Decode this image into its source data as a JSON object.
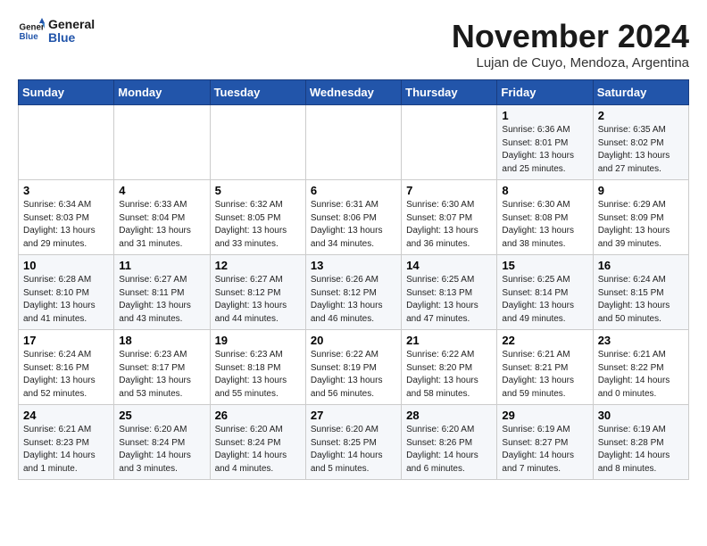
{
  "header": {
    "logo_line1": "General",
    "logo_line2": "Blue",
    "month_year": "November 2024",
    "location": "Lujan de Cuyo, Mendoza, Argentina"
  },
  "weekdays": [
    "Sunday",
    "Monday",
    "Tuesday",
    "Wednesday",
    "Thursday",
    "Friday",
    "Saturday"
  ],
  "weeks": [
    [
      {
        "day": "",
        "content": ""
      },
      {
        "day": "",
        "content": ""
      },
      {
        "day": "",
        "content": ""
      },
      {
        "day": "",
        "content": ""
      },
      {
        "day": "",
        "content": ""
      },
      {
        "day": "1",
        "content": "Sunrise: 6:36 AM\nSunset: 8:01 PM\nDaylight: 13 hours\nand 25 minutes."
      },
      {
        "day": "2",
        "content": "Sunrise: 6:35 AM\nSunset: 8:02 PM\nDaylight: 13 hours\nand 27 minutes."
      }
    ],
    [
      {
        "day": "3",
        "content": "Sunrise: 6:34 AM\nSunset: 8:03 PM\nDaylight: 13 hours\nand 29 minutes."
      },
      {
        "day": "4",
        "content": "Sunrise: 6:33 AM\nSunset: 8:04 PM\nDaylight: 13 hours\nand 31 minutes."
      },
      {
        "day": "5",
        "content": "Sunrise: 6:32 AM\nSunset: 8:05 PM\nDaylight: 13 hours\nand 33 minutes."
      },
      {
        "day": "6",
        "content": "Sunrise: 6:31 AM\nSunset: 8:06 PM\nDaylight: 13 hours\nand 34 minutes."
      },
      {
        "day": "7",
        "content": "Sunrise: 6:30 AM\nSunset: 8:07 PM\nDaylight: 13 hours\nand 36 minutes."
      },
      {
        "day": "8",
        "content": "Sunrise: 6:30 AM\nSunset: 8:08 PM\nDaylight: 13 hours\nand 38 minutes."
      },
      {
        "day": "9",
        "content": "Sunrise: 6:29 AM\nSunset: 8:09 PM\nDaylight: 13 hours\nand 39 minutes."
      }
    ],
    [
      {
        "day": "10",
        "content": "Sunrise: 6:28 AM\nSunset: 8:10 PM\nDaylight: 13 hours\nand 41 minutes."
      },
      {
        "day": "11",
        "content": "Sunrise: 6:27 AM\nSunset: 8:11 PM\nDaylight: 13 hours\nand 43 minutes."
      },
      {
        "day": "12",
        "content": "Sunrise: 6:27 AM\nSunset: 8:12 PM\nDaylight: 13 hours\nand 44 minutes."
      },
      {
        "day": "13",
        "content": "Sunrise: 6:26 AM\nSunset: 8:12 PM\nDaylight: 13 hours\nand 46 minutes."
      },
      {
        "day": "14",
        "content": "Sunrise: 6:25 AM\nSunset: 8:13 PM\nDaylight: 13 hours\nand 47 minutes."
      },
      {
        "day": "15",
        "content": "Sunrise: 6:25 AM\nSunset: 8:14 PM\nDaylight: 13 hours\nand 49 minutes."
      },
      {
        "day": "16",
        "content": "Sunrise: 6:24 AM\nSunset: 8:15 PM\nDaylight: 13 hours\nand 50 minutes."
      }
    ],
    [
      {
        "day": "17",
        "content": "Sunrise: 6:24 AM\nSunset: 8:16 PM\nDaylight: 13 hours\nand 52 minutes."
      },
      {
        "day": "18",
        "content": "Sunrise: 6:23 AM\nSunset: 8:17 PM\nDaylight: 13 hours\nand 53 minutes."
      },
      {
        "day": "19",
        "content": "Sunrise: 6:23 AM\nSunset: 8:18 PM\nDaylight: 13 hours\nand 55 minutes."
      },
      {
        "day": "20",
        "content": "Sunrise: 6:22 AM\nSunset: 8:19 PM\nDaylight: 13 hours\nand 56 minutes."
      },
      {
        "day": "21",
        "content": "Sunrise: 6:22 AM\nSunset: 8:20 PM\nDaylight: 13 hours\nand 58 minutes."
      },
      {
        "day": "22",
        "content": "Sunrise: 6:21 AM\nSunset: 8:21 PM\nDaylight: 13 hours\nand 59 minutes."
      },
      {
        "day": "23",
        "content": "Sunrise: 6:21 AM\nSunset: 8:22 PM\nDaylight: 14 hours\nand 0 minutes."
      }
    ],
    [
      {
        "day": "24",
        "content": "Sunrise: 6:21 AM\nSunset: 8:23 PM\nDaylight: 14 hours\nand 1 minute."
      },
      {
        "day": "25",
        "content": "Sunrise: 6:20 AM\nSunset: 8:24 PM\nDaylight: 14 hours\nand 3 minutes."
      },
      {
        "day": "26",
        "content": "Sunrise: 6:20 AM\nSunset: 8:24 PM\nDaylight: 14 hours\nand 4 minutes."
      },
      {
        "day": "27",
        "content": "Sunrise: 6:20 AM\nSunset: 8:25 PM\nDaylight: 14 hours\nand 5 minutes."
      },
      {
        "day": "28",
        "content": "Sunrise: 6:20 AM\nSunset: 8:26 PM\nDaylight: 14 hours\nand 6 minutes."
      },
      {
        "day": "29",
        "content": "Sunrise: 6:19 AM\nSunset: 8:27 PM\nDaylight: 14 hours\nand 7 minutes."
      },
      {
        "day": "30",
        "content": "Sunrise: 6:19 AM\nSunset: 8:28 PM\nDaylight: 14 hours\nand 8 minutes."
      }
    ]
  ]
}
